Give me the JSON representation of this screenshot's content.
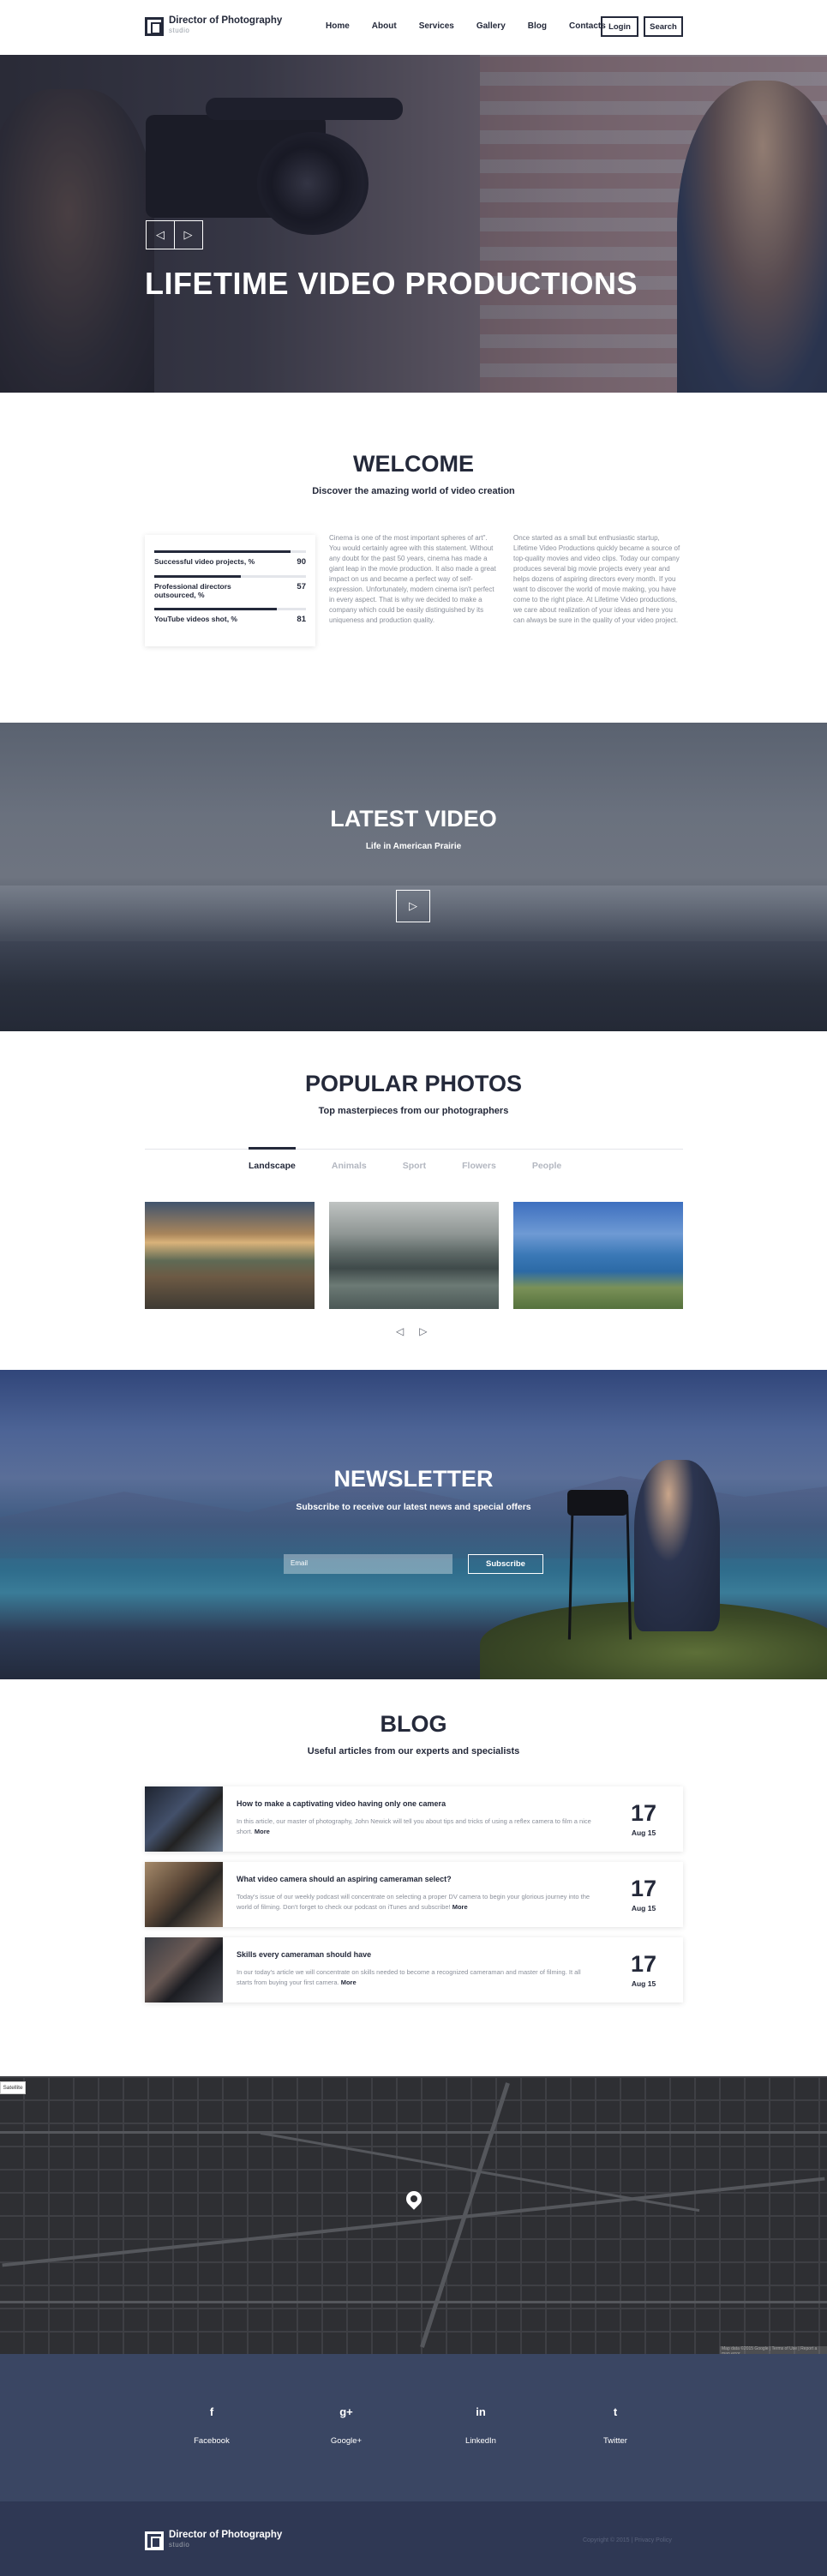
{
  "header": {
    "logo_title": "Director of Photography",
    "logo_sub": "studio",
    "nav": [
      "Home",
      "About",
      "Services",
      "Gallery",
      "Blog",
      "Contacts"
    ],
    "login_label": "Login",
    "search_label": "Search"
  },
  "hero": {
    "title": "LIFETIME VIDEO PRODUCTIONS",
    "prev_icon": "triangle-left-icon",
    "next_icon": "triangle-right-icon"
  },
  "welcome": {
    "title": "WELCOME",
    "subtitle": "Discover the amazing world of video creation",
    "stats": [
      {
        "label": "Successful video projects, %",
        "value": "90",
        "fill": 0.9
      },
      {
        "label": "Professional directors outsourced, %",
        "value": "57",
        "fill": 0.57
      },
      {
        "label": "YouTube videos shot, %",
        "value": "81",
        "fill": 0.81
      }
    ],
    "text_left": "Cinema is one of the most important spheres of art\". You would certainly agree with this statement. Without any doubt for the past 50 years, cinema has made a giant leap in the movie production. It also made a great impact on us and became a perfect way of self-expression. Unfortunately, modern cinema isn't perfect in every aspect. That is why we decided to make a company which could be easily distinguished by its uniqueness and production quality.",
    "text_right": "Once started as a small but enthusiastic startup, Lifetime Video Productions quickly became a source of top-quality movies and video clips. Today our company produces several big movie projects every year and helps dozens of aspiring directors every month. If you want to discover the world of movie making, you have come to the right place. At Lifetime Video productions, we care about realization of your ideas and here you can always be sure in the quality of your video project."
  },
  "latest_video": {
    "title": "LATEST VIDEO",
    "subtitle": "Life in American Prairie",
    "play_icon": "play-icon"
  },
  "popular_photos": {
    "title": "POPULAR PHOTOS",
    "subtitle": "Top masterpieces from our photographers",
    "tabs": [
      "Landscape",
      "Animals",
      "Sport",
      "Flowers",
      "People"
    ],
    "active_tab": "Landscape"
  },
  "newsletter": {
    "title": "NEWSLETTER",
    "subtitle": "Subscribe to receive our latest news and special offers",
    "email_placeholder": "Email",
    "subscribe_label": "Subscribe"
  },
  "blog": {
    "title": "BLOG",
    "subtitle": "Useful articles from our experts and specialists",
    "posts": [
      {
        "title": "How to make a captivating video having only one camera",
        "text": "In this article, our master of photography, John Newick will tell you about tips and tricks of using a reflex camera to film a nice short.",
        "more": "More",
        "day": "17",
        "month": "Aug 15"
      },
      {
        "title": "What video camera should an aspiring cameraman select?",
        "text": "Today's issue of our weekly podcast will concentrate on selecting a proper DV camera to begin your glorious journey into the world of filming. Don't forget to check our podcast on iTunes and subscribe!",
        "more": "More",
        "day": "17",
        "month": "Aug 15"
      },
      {
        "title": "Skills every cameraman should have",
        "text": "In our today's article we will concentrate on skills needed to become a recognized cameraman and master of filming. It all starts from buying your first camera.",
        "more": "More",
        "day": "17",
        "month": "Aug 15"
      }
    ]
  },
  "map": {
    "toggle_label": "Satellite",
    "credit": "Map data ©2015 Google | Terms of Use | Report a map error"
  },
  "social": [
    {
      "icon": "f",
      "label": "Facebook"
    },
    {
      "icon": "g+",
      "label": "Google+"
    },
    {
      "icon": "in",
      "label": "LinkedIn"
    },
    {
      "icon": "t",
      "label": "Twitter"
    }
  ],
  "footer": {
    "logo_title": "Director of Photography",
    "logo_sub": "studio",
    "copyright": "Copyright © 2015 | Privacy Policy"
  }
}
